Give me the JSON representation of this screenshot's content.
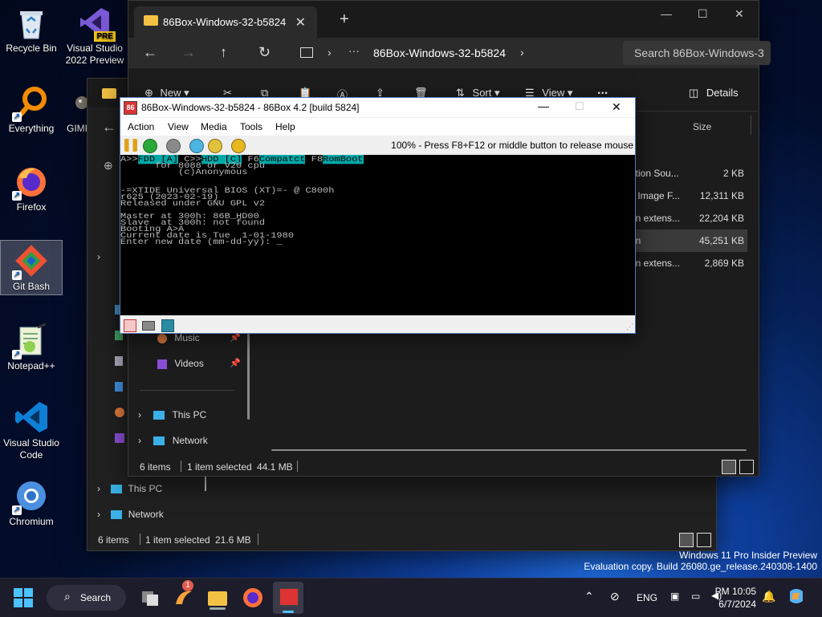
{
  "desktop": {
    "icons": [
      {
        "label": "Recycle Bin",
        "icon": "recycle-bin-icon"
      },
      {
        "label": "Visual Studio 2022 Preview",
        "icon": "visual-studio-icon",
        "badge": "PRE"
      },
      {
        "label": "Everything",
        "icon": "everything-search-icon"
      },
      {
        "label": "GIMP",
        "icon": "gimp-icon"
      },
      {
        "label": "Firefox",
        "icon": "firefox-icon"
      },
      {
        "label": "Git Bash",
        "icon": "git-bash-icon"
      },
      {
        "label": "Notepad++",
        "icon": "notepad-plus-plus-icon"
      },
      {
        "label": "Visual Studio Code",
        "icon": "vscode-icon"
      },
      {
        "label": "Chromium",
        "icon": "chromium-icon"
      }
    ],
    "watermark_line1": "Windows 11 Pro Insider Preview",
    "watermark_line2": "Evaluation copy. Build 26080.ge_release.240308-1400"
  },
  "explorer_front": {
    "tab_title": "86Box-Windows-32-b5824",
    "breadcrumb": "86Box-Windows-32-b5824",
    "search_placeholder": "Search 86Box-Windows-3",
    "toolbar": {
      "new": "New",
      "sort": "Sort",
      "view": "View",
      "more": "...",
      "details": "Details"
    },
    "column_size": "Size",
    "rows": [
      {
        "name": "ation Sou...",
        "size": "2 KB"
      },
      {
        "name": "k Image F...",
        "size": "12,311 KB"
      },
      {
        "name": "on extens...",
        "size": "22,204 KB"
      },
      {
        "name": "on",
        "size": "45,251 KB",
        "selected": true
      },
      {
        "name": "on extens...",
        "size": "2,869 KB"
      },
      {
        "name": "r",
        "size": ""
      }
    ],
    "nav": [
      {
        "label": "Music"
      },
      {
        "label": "Videos"
      },
      {
        "label": "This PC"
      },
      {
        "label": "Network"
      }
    ],
    "status_items": "6 items",
    "status_selected": "1 item selected",
    "status_size": "44.1 MB"
  },
  "explorer_back": {
    "nav": [
      {
        "label": "This PC"
      },
      {
        "label": "Network"
      }
    ],
    "status_items": "6 items",
    "status_selected": "1 item selected",
    "status_size": "21.6 MB"
  },
  "emulator": {
    "title": "86Box-Windows-32-b5824 - 86Box 4.2 [build 5824]",
    "menus": [
      "Action",
      "View",
      "Media",
      "Tools",
      "Help"
    ],
    "hint": "100% - Press F8+F12 or middle button to release mouse",
    "screen": {
      "l0a": "A>>",
      "l0b": "FDD [A]",
      "l0c": " C>>",
      "l0d": "HDD [C]",
      "l0e": " F6",
      "l0f": "Compatct",
      "l0g": " F8",
      "l0h": "RomBoot",
      "l1": "      for 8088 or V20 cpu",
      "l2": "          (c)Anonymous",
      "l3": "-=XTIDE Universal BIOS (XT)=- @ C800h",
      "l4": "r625 (2023-02-19)",
      "l5": "Released under GNU GPL v2",
      "l6": "Master at 300h: 86B_HD00",
      "l7": "Slave  at 300h: not found",
      "l8": "Booting A>A",
      "l9": "Current date is Tue  1-01-1980",
      "l10": "Enter new date (mm-dd-yy): _"
    }
  },
  "taskbar": {
    "search_label": "Search",
    "notification_badge": "1",
    "language": "ENG",
    "time": "10:05 PM",
    "date": "6/7/2024"
  }
}
